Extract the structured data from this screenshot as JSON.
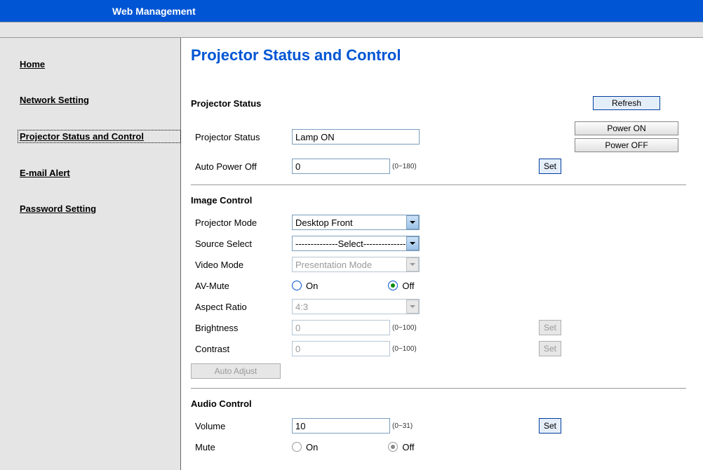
{
  "header": {
    "title": "Web Management"
  },
  "sidebar": {
    "items": [
      {
        "label": "Home"
      },
      {
        "label": "Network Setting"
      },
      {
        "label": "Projector Status and Control"
      },
      {
        "label": "E-mail Alert"
      },
      {
        "label": "Password Setting"
      }
    ]
  },
  "page": {
    "title": "Projector Status and Control"
  },
  "status": {
    "heading": "Projector Status",
    "row_label": "Projector Status",
    "row_value": "Lamp ON",
    "auto_off_label": "Auto Power Off",
    "auto_off_value": "0",
    "auto_off_range": "(0~180)",
    "refresh": "Refresh",
    "power_on": "Power ON",
    "power_off": "Power OFF",
    "set": "Set"
  },
  "image": {
    "heading": "Image Control",
    "mode_label": "Projector Mode",
    "mode_value": "Desktop Front",
    "source_label": "Source Select",
    "source_value": "--------------Select---------------",
    "video_label": "Video Mode",
    "video_value": "Presentation Mode",
    "avmute_label": "AV-Mute",
    "avmute_on": "On",
    "avmute_off": "Off",
    "aspect_label": "Aspect Ratio",
    "aspect_value": "4:3",
    "brightness_label": "Brightness",
    "brightness_value": "0",
    "brightness_range": "(0~100)",
    "contrast_label": "Contrast",
    "contrast_value": "0",
    "contrast_range": "(0~100)",
    "set": "Set",
    "auto_adjust": "Auto Adjust"
  },
  "audio": {
    "heading": "Audio Control",
    "volume_label": "Volume",
    "volume_value": "10",
    "volume_range": "(0~31)",
    "set": "Set",
    "mute_label": "Mute",
    "mute_on": "On",
    "mute_off": "Off"
  }
}
